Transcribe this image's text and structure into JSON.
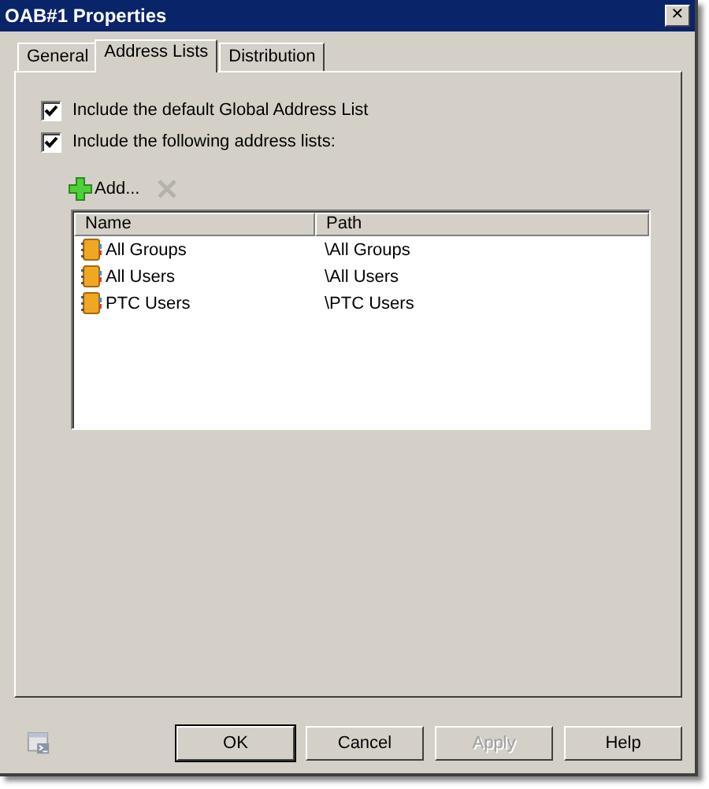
{
  "window": {
    "title": "OAB#1 Properties",
    "close": "✕"
  },
  "tabs": [
    {
      "label": "General",
      "selected": false
    },
    {
      "label": "Address Lists",
      "selected": true
    },
    {
      "label": "Distribution",
      "selected": false
    }
  ],
  "options": [
    {
      "label": "Include the default Global Address List",
      "checked": true
    },
    {
      "label": "Include the following address lists:",
      "checked": true
    }
  ],
  "toolbar": {
    "add": "Add...",
    "remove_disabled": true
  },
  "table": {
    "columns": [
      "Name",
      "Path"
    ],
    "rows": [
      [
        "All Groups",
        "\\All Groups"
      ],
      [
        "All Users",
        "\\All Users"
      ],
      [
        "PTC Users",
        "\\PTC Users"
      ]
    ]
  },
  "buttons": [
    {
      "label": "OK",
      "default": true,
      "disabled": false
    },
    {
      "label": "Cancel",
      "default": false,
      "disabled": false
    },
    {
      "label": "Apply",
      "default": false,
      "disabled": true
    },
    {
      "label": "Help",
      "default": false,
      "disabled": false
    }
  ]
}
